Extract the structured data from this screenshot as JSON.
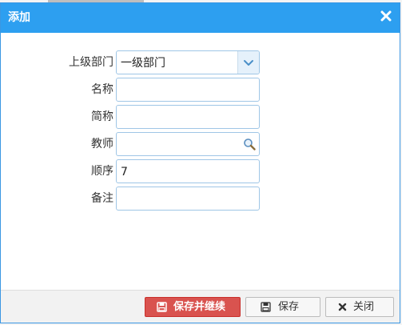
{
  "dialog": {
    "title": "添加"
  },
  "form": {
    "parent_dept": {
      "label": "上级部门",
      "value": "一级部门"
    },
    "name": {
      "label": "名称",
      "value": ""
    },
    "short_name": {
      "label": "简称",
      "value": ""
    },
    "teacher": {
      "label": "教师",
      "value": ""
    },
    "order": {
      "label": "顺序",
      "value": "7"
    },
    "remark": {
      "label": "备注",
      "value": ""
    }
  },
  "footer": {
    "save_continue_label": "保存并继续",
    "save_label": "保存",
    "close_label": "关闭"
  },
  "colors": {
    "titlebar": "#2d9ff0",
    "primary_button": "#d9534f",
    "field_border": "#9fc6e6"
  },
  "icons": {
    "close": "close-icon",
    "dropdown": "chevron-down-icon",
    "search": "search-icon",
    "save": "floppy-disk-icon",
    "cancel": "close-icon"
  }
}
